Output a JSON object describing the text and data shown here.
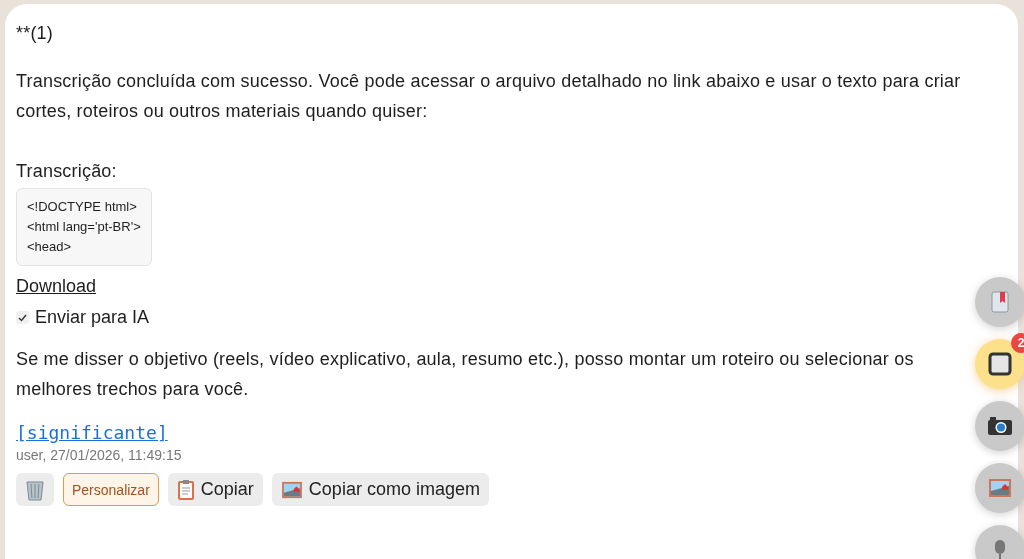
{
  "message": {
    "heading": "**(1)",
    "intro": "Transcrição concluída com sucesso. Você pode acessar o arquivo detalhado no link abaixo e usar o texto para criar cortes, roteiros ou outros materiais quando quiser:",
    "transcript_label": "Transcrição:",
    "code_lines": [
      "<!DOCTYPE html>",
      "<html lang='pt-BR'>",
      "<head>"
    ],
    "download_link": "Download",
    "send_to_ai": {
      "label": "Enviar para IA",
      "checked": true
    },
    "closing": "Se me disser o objetivo (reels, vídeo explicativo, aula, resumo etc.), posso montar um roteiro ou selecionar os melhores trechos para você.",
    "tag_link": "[significante]",
    "meta": "user, 27/01/2026, 11:49:15",
    "actions": [
      {
        "kind": "trash"
      },
      {
        "kind": "customize",
        "label": "Personalizar"
      },
      {
        "kind": "clipboard",
        "label": "Copiar"
      },
      {
        "kind": "image",
        "label": "Copiar como imagem"
      }
    ]
  },
  "floating_buttons": [
    {
      "kind": "book",
      "selected": false
    },
    {
      "kind": "stop",
      "selected": true,
      "badge": "2"
    },
    {
      "kind": "camera",
      "selected": false
    },
    {
      "kind": "image",
      "selected": false
    },
    {
      "kind": "mic",
      "selected": false
    }
  ]
}
